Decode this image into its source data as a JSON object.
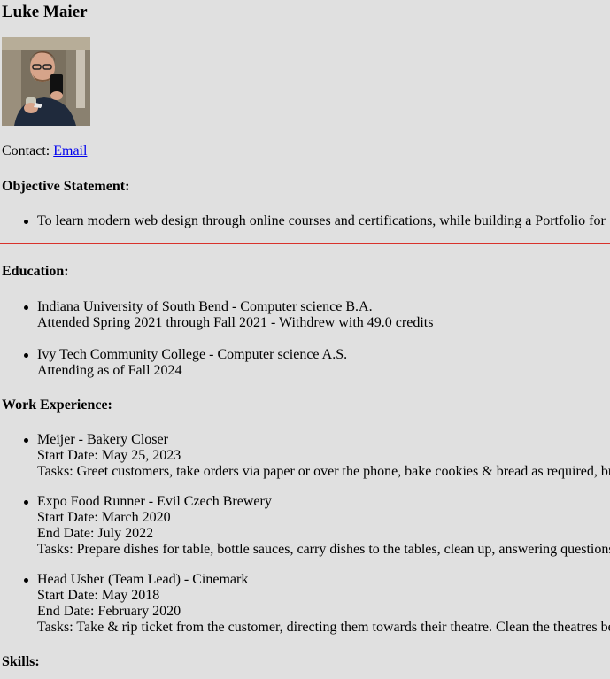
{
  "profile": {
    "name": "Luke Maier",
    "photo_alt": "Luke Maier",
    "contact_label": "Contact:",
    "email_link": "Email"
  },
  "objective": {
    "heading": "Objective Statement:",
    "items": [
      "To learn modern web design through online courses and certifications, while building a Portfolio for"
    ]
  },
  "education": {
    "heading": "Education:",
    "items": [
      {
        "line1": "Indiana University of South Bend - Computer science B.A.",
        "line2": "Attended Spring 2021 through Fall 2021 - Withdrew with 49.0 credits"
      },
      {
        "line1": "Ivy Tech Community College - Computer science A.S.",
        "line2": "Attending as of Fall 2024"
      }
    ]
  },
  "work": {
    "heading": "Work Experience:",
    "items": [
      {
        "title": "Meijer - Bakery Closer",
        "start": "Start Date: May 25, 2023",
        "tasks": "Tasks: Greet customers, take orders via paper or over the phone, bake cookies & bread as required, br"
      },
      {
        "title": "Expo Food Runner - Evil Czech Brewery",
        "start": "Start Date: March 2020",
        "end": "End Date: July 2022",
        "tasks": "Tasks: Prepare dishes for table, bottle sauces, carry dishes to the tables, clean up, answering questions"
      },
      {
        "title": "Head Usher (Team Lead) - Cinemark",
        "start": "Start Date: May 2018",
        "end": "End Date: February 2020",
        "tasks": "Tasks: Take & rip ticket from the customer, directing them towards their theatre. Clean the theatres be"
      }
    ]
  },
  "skills": {
    "heading": "Skills:"
  },
  "colors": {
    "background": "#e0e0e0",
    "divider": "#d9322b",
    "link": "#0000ee"
  }
}
